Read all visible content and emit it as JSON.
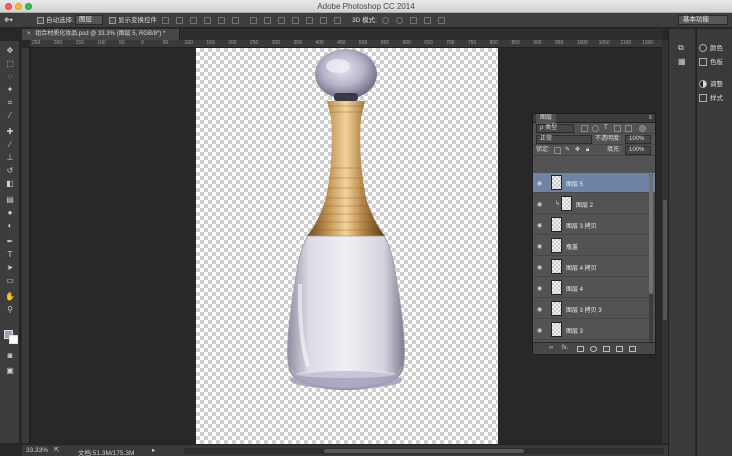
{
  "window": {
    "title": "Adobe Photoshop CC 2014"
  },
  "options_bar": {
    "auto_select_label": "自动选择:",
    "auto_select_target": "图层",
    "show_transform_label": "显示变换控件",
    "mode_3d_label": "3D 模式:",
    "workspace": "基本功能"
  },
  "document": {
    "tab_title": "组合材质化妆品.psd @ 33.3% (图层 5, RGB/8*) *",
    "zoom": "33.33%",
    "doc_size": "文档:51.3M/175.3M"
  },
  "ruler": {
    "h_ticks": [
      "250",
      "200",
      "150",
      "100",
      "50",
      "0",
      "50",
      "100",
      "150",
      "200",
      "250",
      "300",
      "350",
      "400",
      "450",
      "500",
      "550",
      "600",
      "650",
      "700",
      "750",
      "800",
      "850",
      "900",
      "950",
      "1000",
      "1050",
      "1100",
      "1150"
    ]
  },
  "dock": {
    "items": [
      {
        "label": "颜色",
        "icon": "color-wheel-icon"
      },
      {
        "label": "色板",
        "icon": "swatches-grid-icon"
      },
      {
        "label": "调整",
        "icon": "adjustments-icon"
      },
      {
        "label": "样式",
        "icon": "styles-icon"
      }
    ]
  },
  "layers_panel": {
    "tab": "图层",
    "filter_kind": "ρ 类型",
    "blend_mode": "正常",
    "opacity_label": "不透明度:",
    "opacity_value": "100%",
    "lock_label": "锁定:",
    "fill_label": "填充:",
    "fill_value": "100%",
    "layers": [
      {
        "name": "图层 5",
        "active": true,
        "linked": false
      },
      {
        "name": "图层 2",
        "active": false,
        "linked": true
      },
      {
        "name": "图层 3 拷贝",
        "active": false,
        "linked": false
      },
      {
        "name": "瓶盖",
        "active": false,
        "linked": false
      },
      {
        "name": "图层 4 拷贝",
        "active": false,
        "linked": false
      },
      {
        "name": "图层 4",
        "active": false,
        "linked": false
      },
      {
        "name": "图层 3 拷贝 3",
        "active": false,
        "linked": false
      },
      {
        "name": "图层 3",
        "active": false,
        "linked": false
      }
    ],
    "footer_link": "fx."
  },
  "colors": {
    "active_layer": "#6f84a4",
    "gold": "#b8894a",
    "glass": "#d9d6e2"
  }
}
